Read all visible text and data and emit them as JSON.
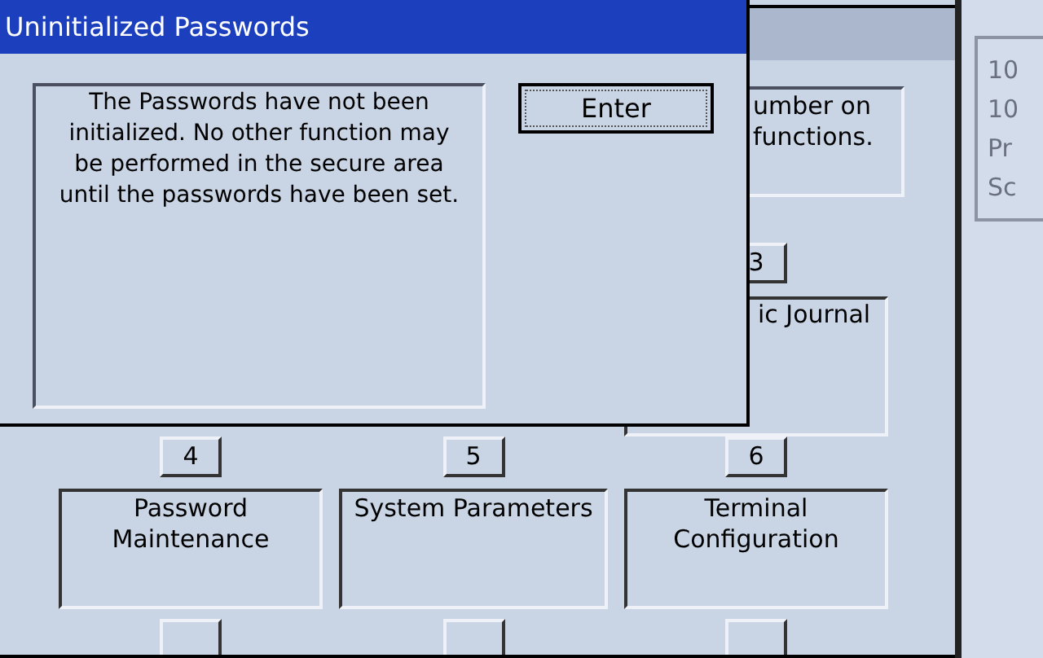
{
  "dialog": {
    "title": "Uninitialized Passwords",
    "message": "The Passwords have not been initialized. No other function may be performed in the secure area until the passwords have been set.",
    "button": "Enter"
  },
  "background_window": {
    "instructions": [
      "umber on",
      "functions."
    ],
    "options": [
      {
        "number": "3",
        "label": "ic Journal"
      },
      {
        "number": "4",
        "label": "Password Maintenance"
      },
      {
        "number": "5",
        "label": "System Parameters"
      },
      {
        "number": "6",
        "label": "Terminal Configuration"
      }
    ]
  },
  "side_panel": {
    "lines": [
      "10",
      "10",
      "Pr",
      "Sc"
    ]
  }
}
